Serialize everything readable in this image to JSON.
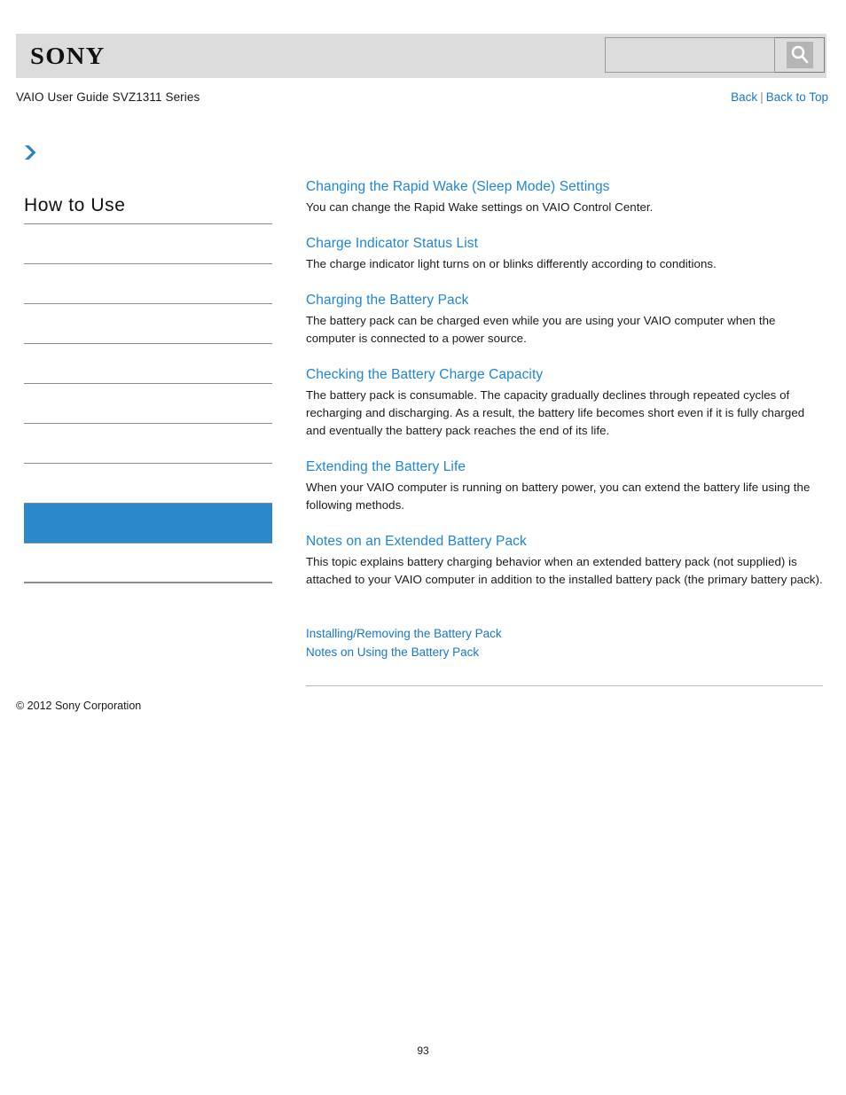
{
  "header": {
    "logo_text": "SONY",
    "search": {
      "value": "",
      "placeholder": "",
      "icon": "search-icon"
    }
  },
  "titlebar": {
    "guide_title": "VAIO User Guide SVZ1311 Series",
    "back_label": "Back",
    "separator": "|",
    "back_to_top_label": "Back to Top"
  },
  "breadcrumb": {
    "arrow_icon": "chevron-right-icon"
  },
  "sidebar": {
    "heading": "How to Use",
    "items": [
      {
        "label": "",
        "selected": false
      },
      {
        "label": "",
        "selected": false
      },
      {
        "label": "",
        "selected": false
      },
      {
        "label": "",
        "selected": false
      },
      {
        "label": "",
        "selected": false
      },
      {
        "label": "",
        "selected": false
      },
      {
        "label": "",
        "selected": false
      },
      {
        "label": "",
        "selected": true
      },
      {
        "label": "",
        "selected": false
      }
    ]
  },
  "content": {
    "topics": [
      {
        "title": "Changing the Rapid Wake (Sleep Mode) Settings",
        "description": "You can change the Rapid Wake settings on VAIO Control Center."
      },
      {
        "title": "Charge Indicator Status List",
        "description": "The charge indicator light turns on or blinks differently according to conditions."
      },
      {
        "title": "Charging the Battery Pack",
        "description": "The battery pack can be charged even while you are using your VAIO computer when the computer is connected to a power source."
      },
      {
        "title": "Checking the Battery Charge Capacity",
        "description": "The battery pack is consumable. The capacity gradually declines through repeated cycles of recharging and discharging. As a result, the battery life becomes short even if it is fully charged and eventually the battery pack reaches the end of its life."
      },
      {
        "title": "Extending the Battery Life",
        "description": "When your VAIO computer is running on battery power, you can extend the battery life using the following methods."
      },
      {
        "title": "Notes on an Extended Battery Pack",
        "description": "This topic explains battery charging behavior when an extended battery pack (not supplied) is attached to your VAIO computer in addition to the installed battery pack (the primary battery pack)."
      }
    ],
    "related_links": [
      "Installing/Removing the Battery Pack",
      "Notes on Using the Battery Pack"
    ]
  },
  "footer": {
    "copyright": "© 2012 Sony Corporation",
    "page_number": "93"
  },
  "colors": {
    "link_blue": "#1d86d6",
    "nav_link_blue": "#1878c8",
    "selected_blue": "#2989ca",
    "header_grey": "#dcdcdc",
    "rule_grey": "#8c8c8c"
  }
}
